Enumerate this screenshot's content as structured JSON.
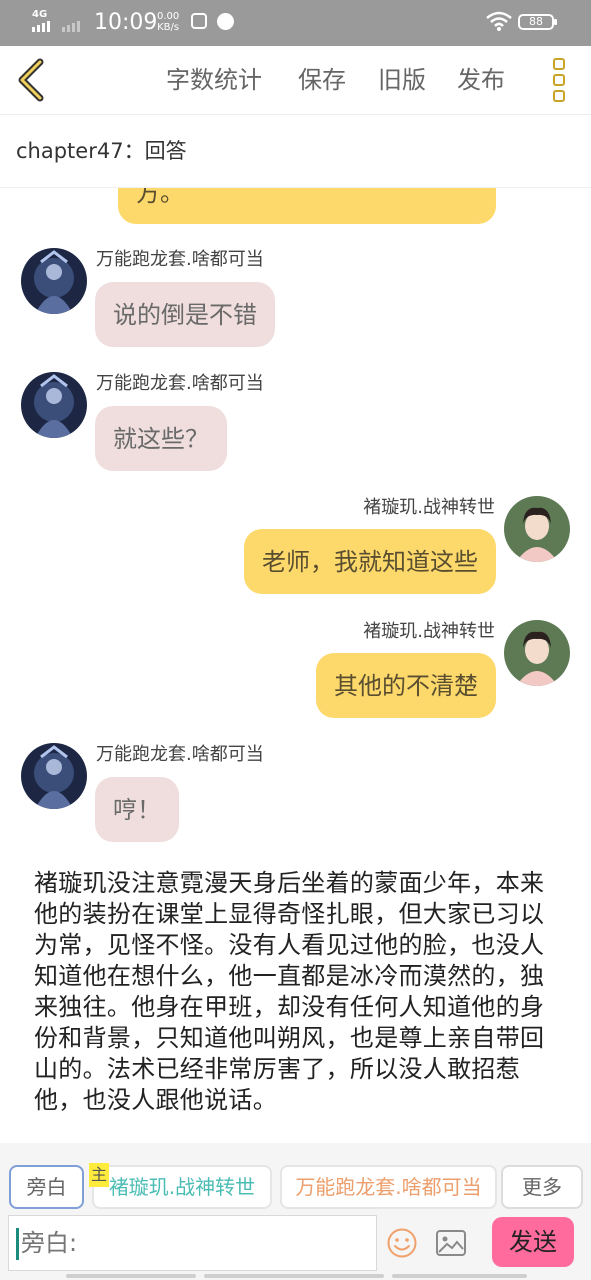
{
  "status_bar": {
    "network": "4G",
    "time": "10:09",
    "speed_value": "0.00",
    "speed_unit": "KB/s",
    "battery": "88"
  },
  "toolbar": {
    "back_icon": "chevron-left-icon",
    "word_count": "字数统计",
    "save": "保存",
    "old_version": "旧版",
    "publish": "发布",
    "more_icon": "vertical-dots-icon"
  },
  "chapter": {
    "title": "chapter47：回答"
  },
  "messages": [
    {
      "side": "right",
      "name": "",
      "text": "方。",
      "avatar": "heroine-avatar"
    },
    {
      "side": "left",
      "name": "万能跑龙套.啥都可当",
      "text": "说的倒是不错",
      "avatar": "armored-character-avatar"
    },
    {
      "side": "left",
      "name": "万能跑龙套.啥都可当",
      "text": "就这些？",
      "avatar": "armored-character-avatar"
    },
    {
      "side": "right",
      "name": "褚璇玑.战神转世",
      "text": "老师，我就知道这些",
      "avatar": "heroine-avatar"
    },
    {
      "side": "right",
      "name": "褚璇玑.战神转世",
      "text": "其他的不清楚",
      "avatar": "heroine-avatar"
    },
    {
      "side": "left",
      "name": "万能跑龙套.啥都可当",
      "text": "哼！",
      "avatar": "armored-character-avatar"
    }
  ],
  "narration": "褚璇玑没注意霓漫天身后坐着的蒙面少年，本来他的装扮在课堂上显得奇怪扎眼，但大家已习以为常，见怪不怪。没有人看见过他的脸，也没人知道他在想什么，他一直都是冰冷而漠然的，独来独往。他身在甲班，却没有任何人知道他的身份和背景，只知道他叫朔风，也是尊上亲自带回山的。法术已经非常厉害了，所以没人敢招惹他，也没人跟他说话。",
  "composer": {
    "chip_narration": "旁白",
    "host_badge": "主",
    "chip_character1": "褚璇玑.战神转世",
    "chip_character2": "万能跑龙套.啥都可当",
    "chip_more": "更多",
    "input_placeholder": "旁白:",
    "emoji_icon": "smiley-icon",
    "image_icon": "image-icon",
    "send": "发送"
  },
  "colors": {
    "accent_yellow": "#fdd96b",
    "pink_bubble": "#f0dede",
    "send_button": "#ff6b9d",
    "icon_gold": "#c9a326"
  }
}
